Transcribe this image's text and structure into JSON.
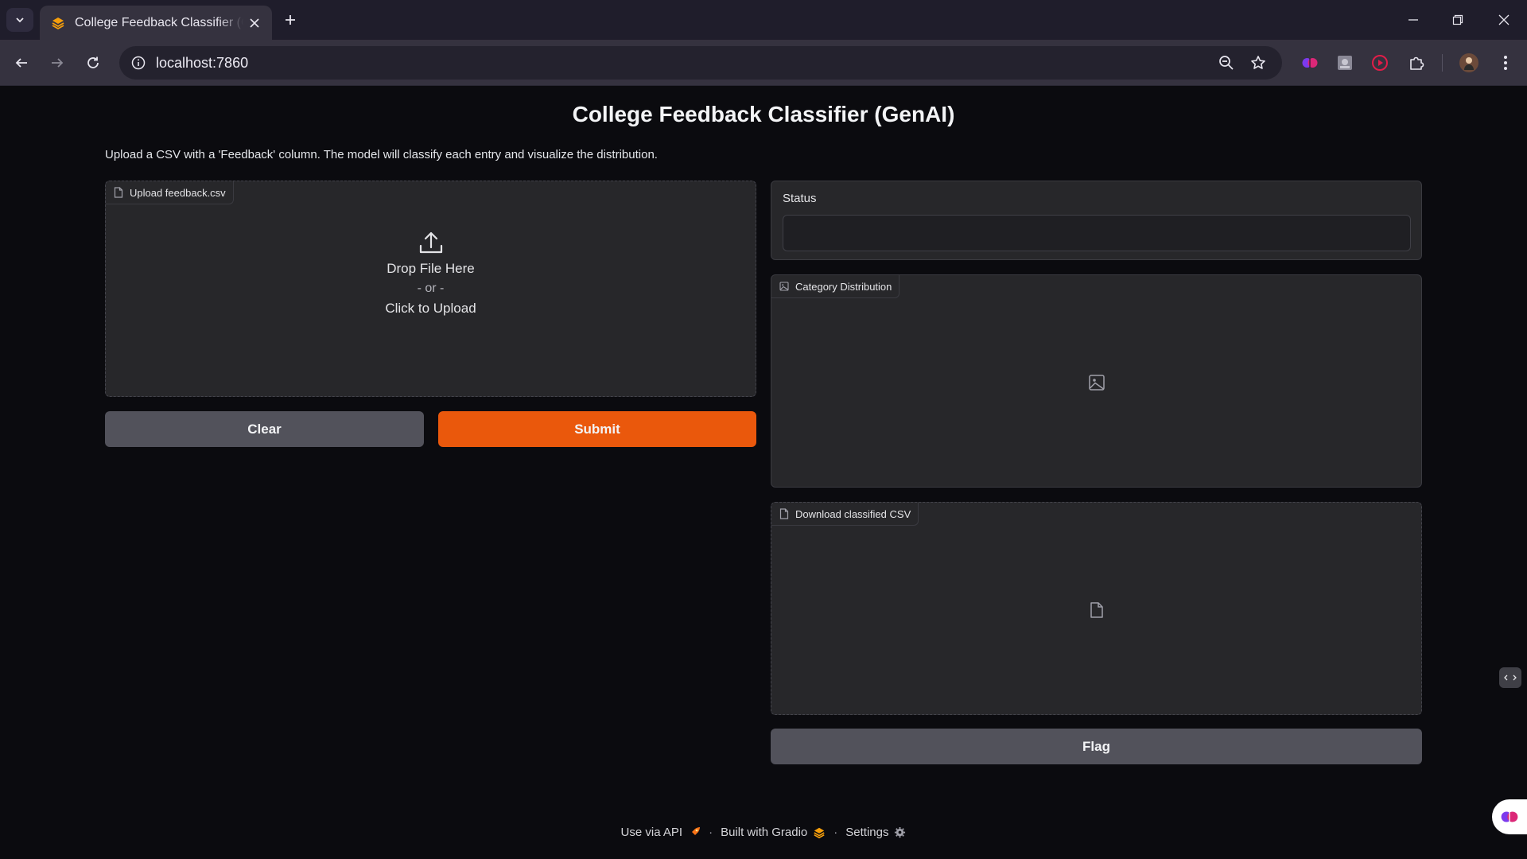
{
  "browser": {
    "tab_title": "College Feedback Classifier (GenAI)",
    "url": "localhost:7860"
  },
  "page": {
    "title": "College Feedback Classifier (GenAI)",
    "description": "Upload a CSV with a 'Feedback' column. The model will classify each entry and visualize the distribution."
  },
  "upload": {
    "label": "Upload feedback.csv",
    "drop_text": "Drop File Here",
    "or_text": "- or -",
    "click_text": "Click to Upload"
  },
  "buttons": {
    "clear": "Clear",
    "submit": "Submit",
    "flag": "Flag"
  },
  "status": {
    "label": "Status",
    "value": ""
  },
  "chart_panel": {
    "label": "Category Distribution"
  },
  "download_panel": {
    "label": "Download classified CSV"
  },
  "footer": {
    "api": "Use via API",
    "built": "Built with Gradio",
    "settings": "Settings",
    "separator": "·"
  },
  "colors": {
    "primary": "#ea580c",
    "secondary": "#52525b",
    "panel": "#27272a",
    "background": "#0b0b0f"
  }
}
